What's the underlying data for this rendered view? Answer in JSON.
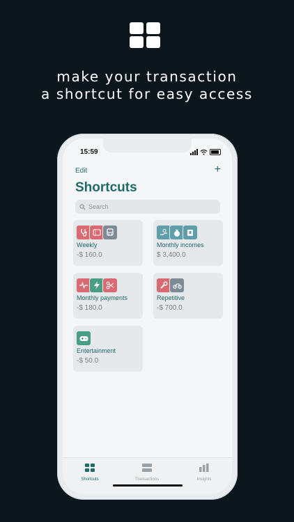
{
  "headline": {
    "line1": "make your transaction",
    "line2": "a shortcut for easy access"
  },
  "status": {
    "time": "15:59"
  },
  "header": {
    "edit_label": "Edit",
    "add_label": "+",
    "title": "Shortcuts"
  },
  "search": {
    "placeholder": "Search"
  },
  "shortcuts": [
    {
      "name": "Weekly",
      "amount": "-$ 160.0",
      "icons": [
        "stethoscope-icon",
        "ticket-icon",
        "bus-icon"
      ]
    },
    {
      "name": "Monthly incomes",
      "amount": "$ 3,400.0",
      "icons": [
        "salary-icon",
        "money-bag-icon",
        "bank-icon"
      ]
    },
    {
      "name": "Monthly payments",
      "amount": "-$ 180.0",
      "icons": [
        "heartbeat-icon",
        "lightning-icon",
        "scissors-icon"
      ]
    },
    {
      "name": "Repetitive",
      "amount": "-$ 700.0",
      "icons": [
        "wrench-icon",
        "motorbike-icon"
      ]
    },
    {
      "name": "Entertainment",
      "amount": "-$ 50.0",
      "icons": [
        "gamepad-icon"
      ]
    }
  ],
  "tabs": [
    {
      "label": "Shortcuts",
      "active": true
    },
    {
      "label": "Transactions",
      "active": false
    },
    {
      "label": "Insights",
      "active": false
    }
  ],
  "colors": {
    "background": "#0c161d",
    "accent": "#1f6b6a",
    "red": "#d96a72",
    "green": "#4a9e86",
    "blue": "#5f9eaa",
    "gray": "#7f8b94"
  }
}
